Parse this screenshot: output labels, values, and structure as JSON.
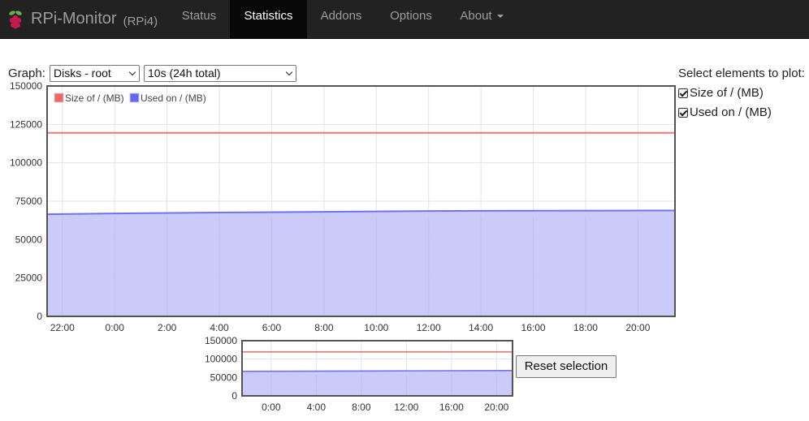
{
  "nav": {
    "brand": "RPi-Monitor",
    "host": "(RPi4)",
    "items": [
      {
        "label": "Status",
        "active": false
      },
      {
        "label": "Statistics",
        "active": true
      },
      {
        "label": "Addons",
        "active": false
      },
      {
        "label": "Options",
        "active": false
      },
      {
        "label": "About",
        "active": false,
        "dropdown": true
      }
    ]
  },
  "controls": {
    "graph_label": "Graph:",
    "graph_select": "Disks - root",
    "range_select": "10s (24h total)",
    "plot_title": "Select elements to plot:",
    "elements": [
      {
        "label": "Size of / (MB)",
        "checked": true
      },
      {
        "label": "Used on / (MB)",
        "checked": true
      }
    ],
    "reset_button": "Reset selection"
  },
  "colors": {
    "size_series": "#ee6666",
    "used_series": "#6666ee",
    "used_fill": "#c8c8fa",
    "navbar_bg": "#222222"
  },
  "chart_data": [
    {
      "type": "area",
      "name": "main",
      "ylim": [
        0,
        150000
      ],
      "yticks": [
        "0",
        "25000",
        "50000",
        "75000",
        "100000",
        "125000",
        "150000"
      ],
      "xticks": [
        "22:00",
        "0:00",
        "2:00",
        "4:00",
        "6:00",
        "8:00",
        "10:00",
        "12:00",
        "14:00",
        "16:00",
        "18:00",
        "20:00"
      ],
      "legend": [
        "Size of / (MB)",
        "Used on / (MB)"
      ],
      "legend_position": "top-left",
      "grid": true,
      "series": [
        {
          "name": "Size of / (MB)",
          "x": [
            "21:25",
            "0:00",
            "4:00",
            "8:00",
            "12:00",
            "16:00",
            "20:00",
            "21:25"
          ],
          "values": [
            119500,
            119500,
            119500,
            119500,
            119500,
            119500,
            119500,
            119500
          ]
        },
        {
          "name": "Used on / (MB)",
          "x": [
            "21:25",
            "0:00",
            "4:00",
            "8:00",
            "12:00",
            "16:00",
            "20:00",
            "21:25"
          ],
          "values": [
            66500,
            67000,
            67600,
            68100,
            68600,
            68800,
            68900,
            68900
          ]
        }
      ]
    },
    {
      "type": "area",
      "name": "overview",
      "ylim": [
        0,
        150000
      ],
      "yticks": [
        "0",
        "50000",
        "100000",
        "150000"
      ],
      "xticks": [
        "0:00",
        "4:00",
        "8:00",
        "12:00",
        "16:00",
        "20:00"
      ],
      "grid": true,
      "series": [
        {
          "name": "Size of / (MB)",
          "values": [
            119500,
            119500,
            119500
          ]
        },
        {
          "name": "Used on / (MB)",
          "values": [
            66500,
            67800,
            68900
          ]
        }
      ]
    }
  ]
}
